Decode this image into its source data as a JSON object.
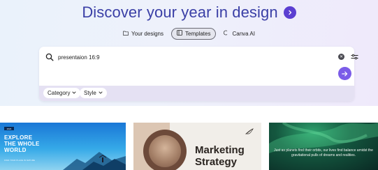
{
  "header": {
    "title": "Discover your year in design",
    "arrow_icon": "chevron-right-icon"
  },
  "tabs": [
    {
      "label": "Your designs",
      "icon": "folder-icon",
      "active": false
    },
    {
      "label": "Templates",
      "icon": "template-icon",
      "active": true
    },
    {
      "label": "Canva AI",
      "icon": "sparkle-icon",
      "active": false
    }
  ],
  "search": {
    "value": "presentaion 16:9",
    "placeholder": ""
  },
  "filters": [
    {
      "label": "Category"
    },
    {
      "label": "Style"
    }
  ],
  "results": [
    {
      "tag": "2024",
      "heading_line1": "EXPLORE",
      "heading_line2": "THE WHOLE",
      "heading_line3": "WORLD",
      "subtext": "FIND YOUR PLACE IN NATURE"
    },
    {
      "heading_line1": "Marketing",
      "heading_line2": "Strategy"
    },
    {
      "quote": "Just as planets find their orbits, our lives find balance amidst the gravitational pulls of dreams and realities."
    }
  ],
  "colors": {
    "accent": "#5b3fd1",
    "headline": "#3a3fa6",
    "submit": "#7b5ce8"
  }
}
